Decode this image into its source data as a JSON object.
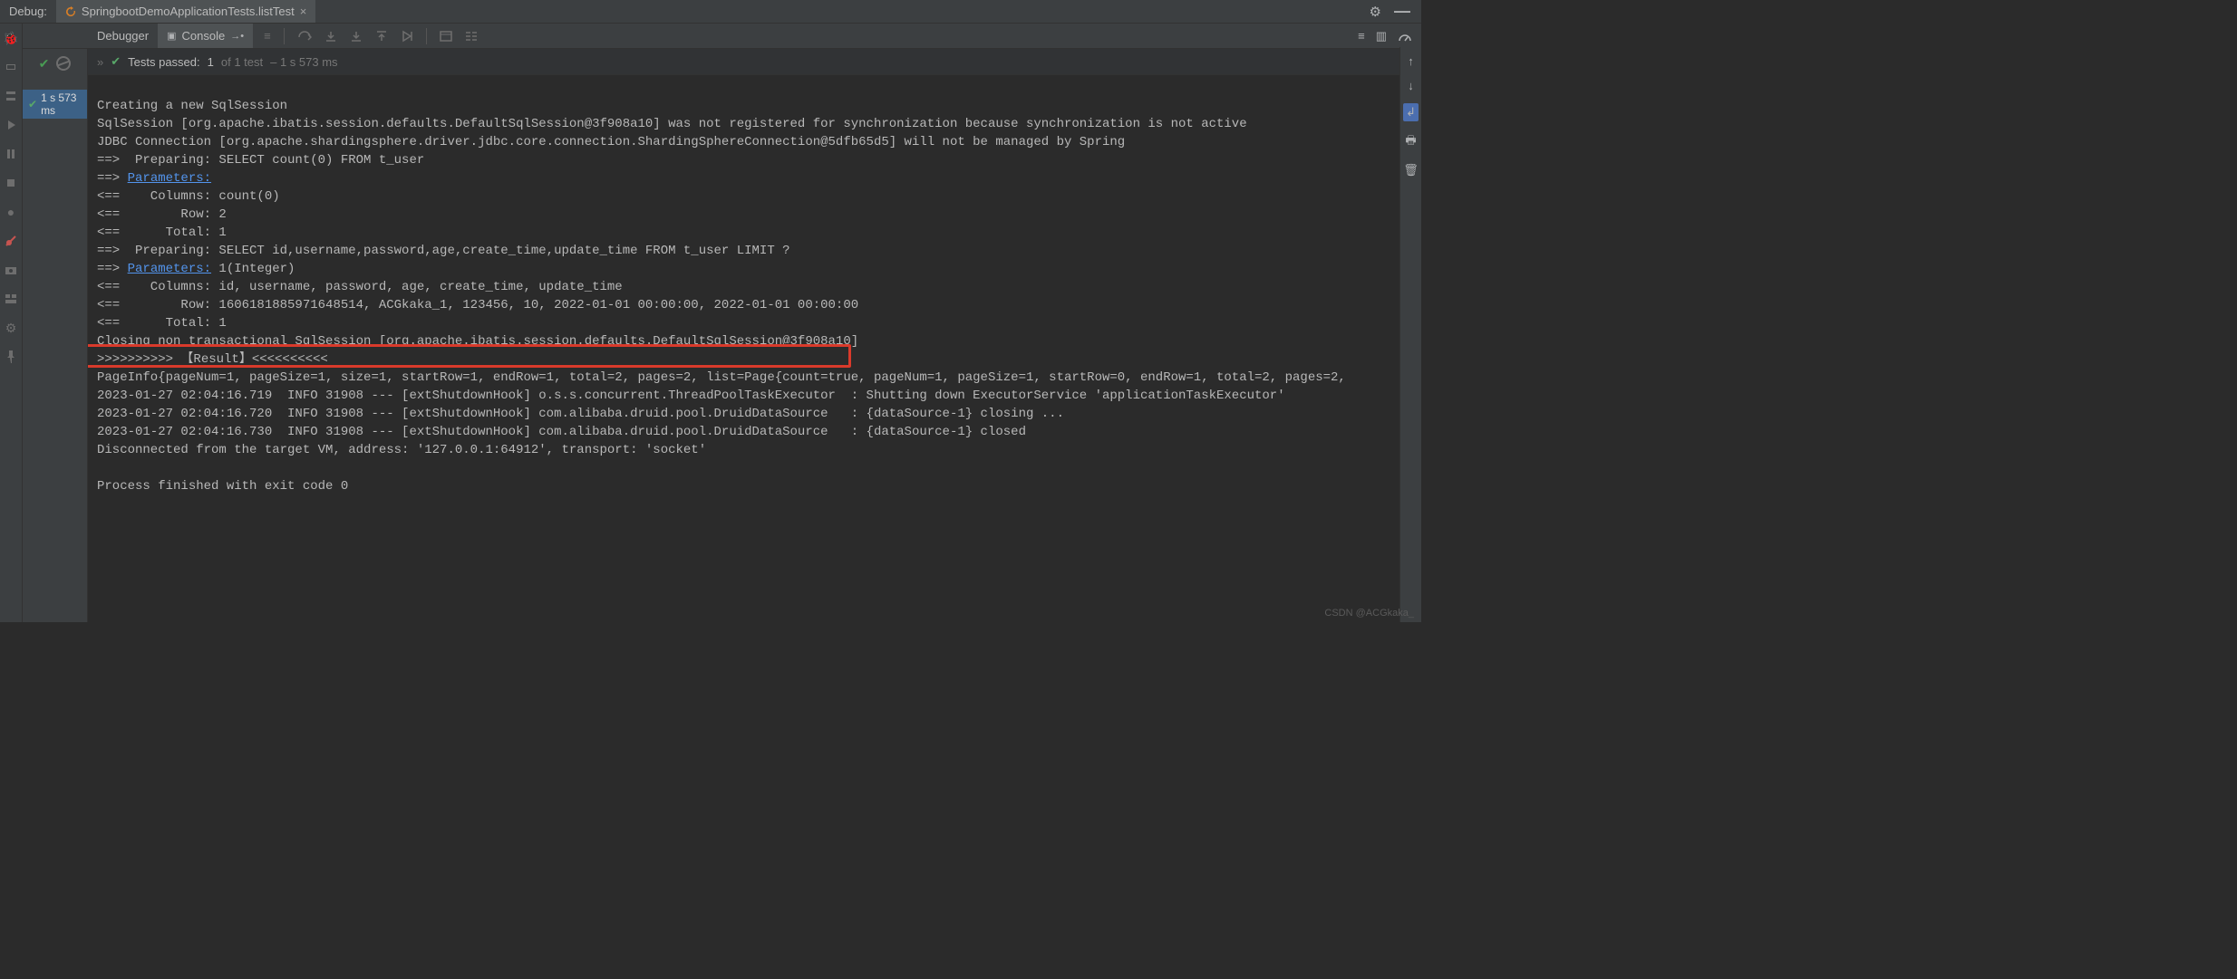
{
  "header": {
    "debug_label": "Debug:",
    "tab_title": "SpringbootDemoApplicationTests.listTest"
  },
  "toolrow": {
    "debugger_label": "Debugger",
    "console_label": "Console"
  },
  "run": {
    "duration_badge": "1 s 573 ms"
  },
  "tests": {
    "prefix": "Tests passed:",
    "count": "1",
    "of": "of 1 test",
    "duration": "– 1 s 573 ms"
  },
  "console": {
    "lines": [
      "Creating a new SqlSession",
      "SqlSession [org.apache.ibatis.session.defaults.DefaultSqlSession@3f908a10] was not registered for synchronization because synchronization is not active",
      "JDBC Connection [org.apache.shardingsphere.driver.jdbc.core.connection.ShardingSphereConnection@5dfb65d5] will not be managed by Spring",
      "==>  Preparing: SELECT count(0) FROM t_user",
      "==> ",
      "<==    Columns: count(0)",
      "<==        Row: 2",
      "<==      Total: 1",
      "==>  Preparing: SELECT id,username,password,age,create_time,update_time FROM t_user LIMIT ?",
      "==> ",
      "<==    Columns: id, username, password, age, create_time, update_time",
      "<==        Row: 1606181885971648514, ACGkaka_1, 123456, 10, 2022-01-01 00:00:00, 2022-01-01 00:00:00",
      "<==      Total: 1",
      "Closing non transactional SqlSession [org.apache.ibatis.session.defaults.DefaultSqlSession@3f908a10]",
      ">>>>>>>>>> 【Result】<<<<<<<<<<",
      "PageInfo{pageNum=1, pageSize=1, size=1, startRow=1, endRow=1, total=2, pages=2, list=Page{count=true, pageNum=1, pageSize=1, startRow=0, endRow=1, total=2, pages=2,",
      "2023-01-27 02:04:16.719  INFO 31908 --- [extShutdownHook] o.s.s.concurrent.ThreadPoolTaskExecutor  : Shutting down ExecutorService 'applicationTaskExecutor'",
      "2023-01-27 02:04:16.720  INFO 31908 --- [extShutdownHook] com.alibaba.druid.pool.DruidDataSource   : {dataSource-1} closing ...",
      "2023-01-27 02:04:16.730  INFO 31908 --- [extShutdownHook] com.alibaba.druid.pool.DruidDataSource   : {dataSource-1} closed",
      "Disconnected from the target VM, address: '127.0.0.1:64912', transport: 'socket'",
      "",
      "Process finished with exit code 0"
    ],
    "param_link_text": "Parameters:",
    "param_link_suffix_2": " 1(Integer)"
  },
  "watermark": "CSDN @ACGkaka_"
}
